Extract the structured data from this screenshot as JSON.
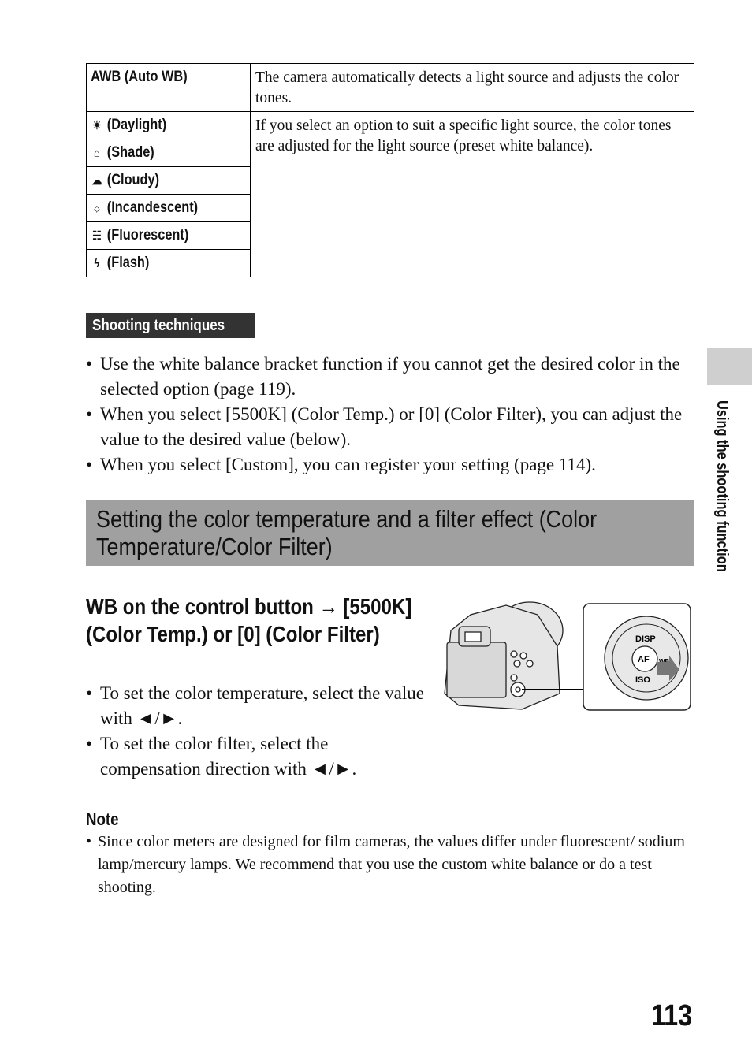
{
  "wb_table": {
    "auto": {
      "label": "AWB (Auto WB)",
      "description": "The camera automatically detects a light source and adjusts the color tones."
    },
    "presets": [
      {
        "icon": "daylight-icon",
        "glyph": "☀",
        "label": "(Daylight)"
      },
      {
        "icon": "shade-icon",
        "glyph": "⌂",
        "label": "(Shade)"
      },
      {
        "icon": "cloudy-icon",
        "glyph": "☁",
        "label": "(Cloudy)"
      },
      {
        "icon": "incandescent-icon",
        "glyph": "☼",
        "label": "(Incandescent)"
      },
      {
        "icon": "fluorescent-icon",
        "glyph": "☵",
        "label": "(Fluorescent)"
      },
      {
        "icon": "flash-icon",
        "glyph": "ϟ",
        "label": "(Flash)"
      }
    ],
    "preset_description": "If you select an option to suit a specific light source, the color tones are adjusted for the light source (preset white balance)."
  },
  "shooting_techniques": {
    "badge": "Shooting techniques",
    "bullets": [
      "Use the white balance bracket function if you cannot get the desired color in the selected option (page 119).",
      "When you select [5500K] (Color Temp.) or [0] (Color Filter), you can adjust the value to the desired value (below).",
      "When you select [Custom], you can register your setting (page 114)."
    ]
  },
  "section": {
    "title": "Setting the color temperature and a filter effect (Color Temperature/Color Filter)",
    "subheading": "WB on the control button → [5500K] (Color Temp.) or [0] (Color Filter)",
    "bullets": [
      "To set the color temperature, select the value with ◄/►.",
      "To set the color filter, select the compensation direction with ◄/►."
    ]
  },
  "illustration": {
    "dial_labels": {
      "top": "DISP",
      "center": "AF",
      "right": "WB",
      "bottom": "ISO"
    }
  },
  "note": {
    "heading": "Note",
    "bullets": [
      "Since color meters are designed for film cameras, the values differ under fluorescent/ sodium lamp/mercury lamps. We recommend that you use the custom white balance or do a test shooting."
    ]
  },
  "side_tab": {
    "label": "Using the shooting function"
  },
  "page_number": "113"
}
